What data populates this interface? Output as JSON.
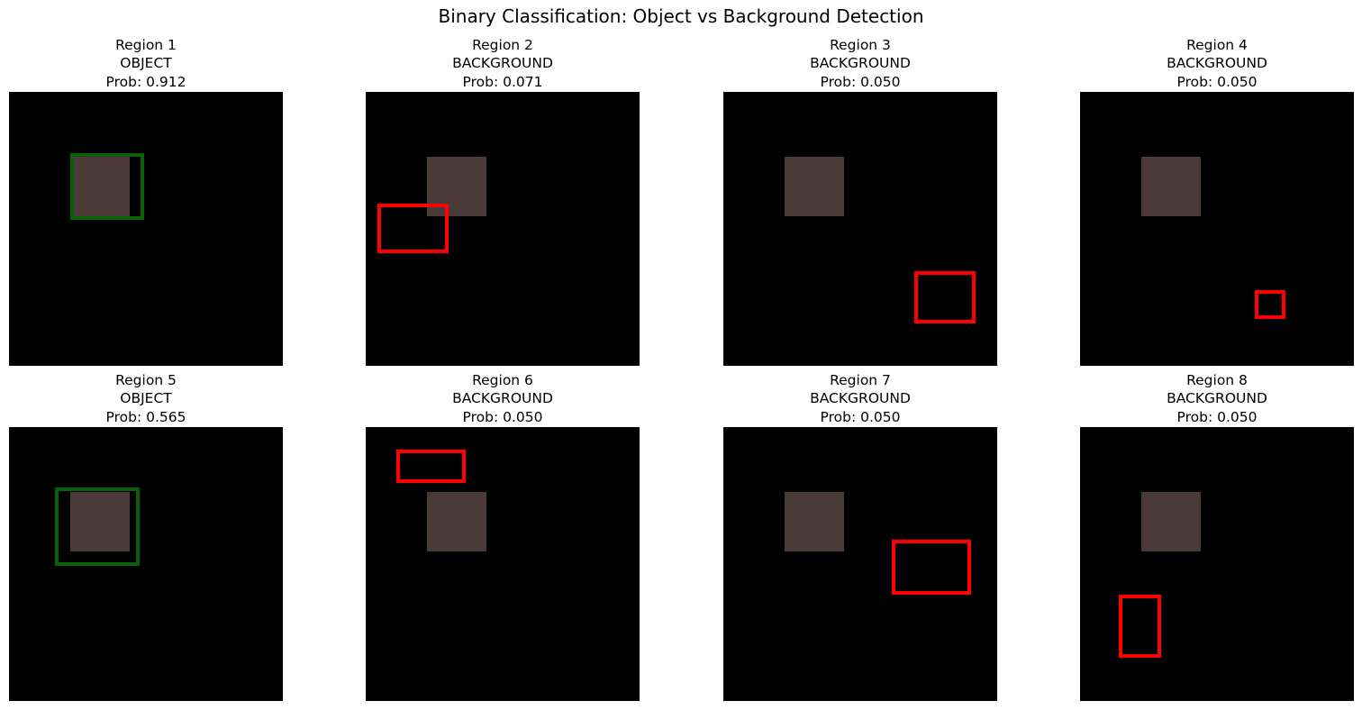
{
  "figure": {
    "title": "Binary Classification: Object vs Background Detection"
  },
  "colors": {
    "object_box": "#0b5f0b",
    "background_box": "#ff0000",
    "object_fill": "#4a3a3a",
    "canvas": "#000000"
  },
  "panels": [
    {
      "region": "Region 1",
      "label": "OBJECT",
      "prob": "Prob: 0.912",
      "kind": "object"
    },
    {
      "region": "Region 2",
      "label": "BACKGROUND",
      "prob": "Prob: 0.071",
      "kind": "background"
    },
    {
      "region": "Region 3",
      "label": "BACKGROUND",
      "prob": "Prob: 0.050",
      "kind": "background"
    },
    {
      "region": "Region 4",
      "label": "BACKGROUND",
      "prob": "Prob: 0.050",
      "kind": "background"
    },
    {
      "region": "Region 5",
      "label": "OBJECT",
      "prob": "Prob: 0.565",
      "kind": "object"
    },
    {
      "region": "Region 6",
      "label": "BACKGROUND",
      "prob": "Prob: 0.050",
      "kind": "background"
    },
    {
      "region": "Region 7",
      "label": "BACKGROUND",
      "prob": "Prob: 0.050",
      "kind": "background"
    },
    {
      "region": "Region 8",
      "label": "BACKGROUND",
      "prob": "Prob: 0.050",
      "kind": "background"
    }
  ]
}
